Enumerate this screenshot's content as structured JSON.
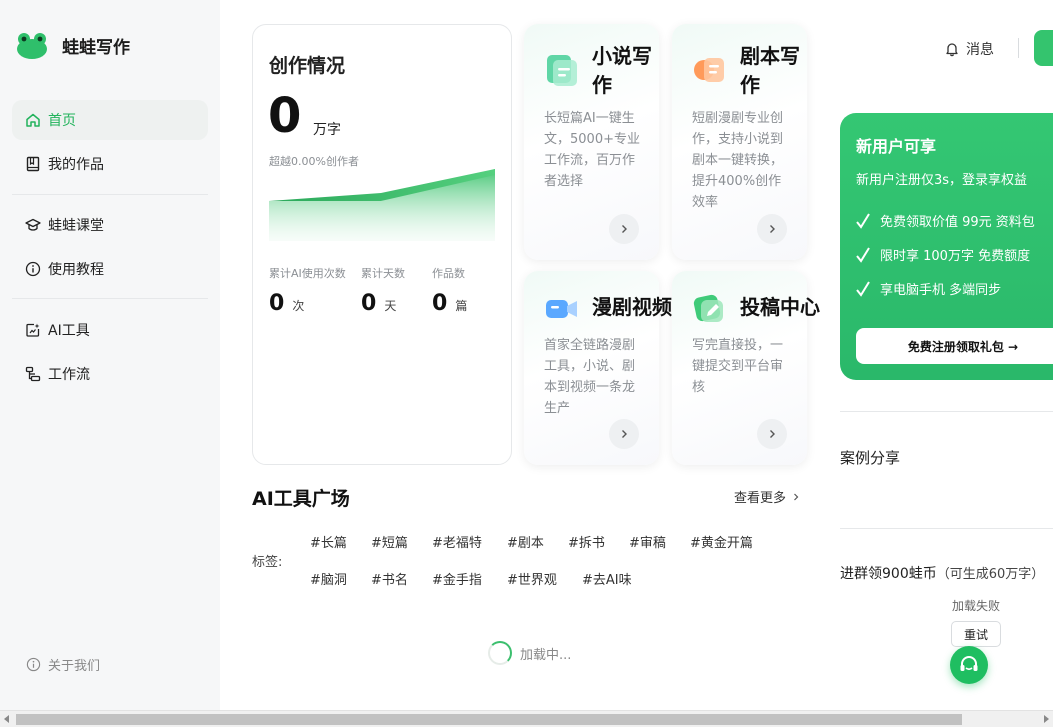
{
  "app": {
    "name": "蛙蛙写作"
  },
  "sidebar": {
    "items": [
      {
        "label": "首页",
        "icon": "home-icon",
        "active": true
      },
      {
        "label": "我的作品",
        "icon": "book-icon"
      },
      {
        "label": "蛙蛙课堂",
        "icon": "graduation-cap-icon"
      },
      {
        "label": "使用教程",
        "icon": "info-circle-icon"
      },
      {
        "label": "AI工具",
        "icon": "ai-tool-icon"
      },
      {
        "label": "工作流",
        "icon": "workflow-icon"
      }
    ],
    "about": "关于我们"
  },
  "stats": {
    "title": "创作情况",
    "total": "0",
    "total_unit": "万字",
    "subtitle": "超越0.00%创作者",
    "metrics": [
      {
        "label": "累计AI使用次数",
        "value": "0",
        "unit": "次"
      },
      {
        "label": "累计天数",
        "value": "0",
        "unit": "天"
      },
      {
        "label": "作品数",
        "value": "0",
        "unit": "篇"
      }
    ]
  },
  "features": [
    {
      "title": "小说写作",
      "desc": "长短篇AI一键生文，5000+专业工作流，百万作者选择",
      "icon": "novel-icon"
    },
    {
      "title": "剧本写作",
      "desc": "短剧漫剧专业创作，支持小说到剧本一键转换，提升400%创作效率",
      "icon": "script-icon"
    },
    {
      "title": "漫剧视频",
      "desc": "首家全链路漫剧工具，小说、剧本到视频一条龙生产",
      "icon": "video-icon"
    },
    {
      "title": "投稿中心",
      "desc": "写完直接投，一键提交到平台审核",
      "icon": "submit-icon"
    }
  ],
  "tools": {
    "title": "AI工具广场",
    "see_more": "查看更多",
    "tags_label": "标签:",
    "tags_row1": [
      "#长篇",
      "#短篇",
      "#老福特",
      "#剧本",
      "#拆书",
      "#审稿",
      "#黄金开篇"
    ],
    "tags_row2": [
      "#脑洞",
      "#书名",
      "#金手指",
      "#世界观",
      "#去AI味"
    ],
    "loading": "加载中..."
  },
  "topbar": {
    "messages": "消息"
  },
  "promo": {
    "title": "新用户可享",
    "subtitle": "新用户注册仅3s，登录享权益",
    "items": [
      "免费领取价值 99元 资料包",
      "限时享 100万字 免费额度",
      "享电脑手机 多端同步"
    ],
    "button": "免费注册领取礼包 →"
  },
  "right": {
    "case_title": "案例分享",
    "group_title": "进群领900蛙币",
    "group_note": "（可生成60万字）",
    "fail": "加载失败",
    "retry": "重试"
  },
  "colors": {
    "accent": "#2ab86a",
    "accent_dark": "#1fbe61"
  }
}
